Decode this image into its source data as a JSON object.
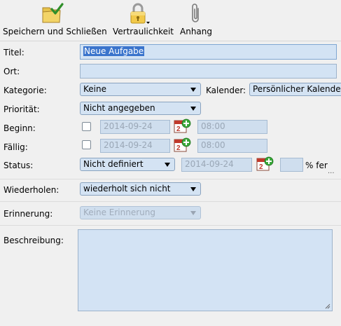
{
  "toolbar": {
    "save_close": "Speichern und Schließen",
    "confidentiality": "Vertraulichkeit",
    "attachment": "Anhang"
  },
  "form": {
    "title_label": "Titel:",
    "title_value": "Neue Aufgabe",
    "location_label": "Ort:",
    "location_value": "",
    "category_label": "Kategorie:",
    "category_value": "Keine",
    "calendar_label": "Kalender:",
    "calendar_value": "Persönlicher Kalende",
    "priority_label": "Priorität:",
    "priority_value": "Nicht angegeben",
    "start_label": "Beginn:",
    "start_date": "2014-09-24",
    "start_time": "08:00",
    "due_label": "Fällig:",
    "due_date": "2014-09-24",
    "due_time": "08:00",
    "status_label": "Status:",
    "status_value": "Nicht definiert",
    "status_date": "2014-09-24",
    "percent_value": "",
    "percent_label": "% fer",
    "more_dots": "...",
    "repeat_label": "Wiederholen:",
    "repeat_value": "wiederholt sich nicht",
    "reminder_label": "Erinnerung:",
    "reminder_value": "Keine Erinnerung",
    "description_label": "Beschreibung:",
    "description_value": ""
  },
  "colors": {
    "field_bg": "#d3e3f4",
    "field_border": "#9db3cb",
    "selection": "#3a74cc",
    "background": "#f0f0f0"
  },
  "icons": {
    "save_close": "folder-checkmark-icon",
    "confidentiality": "padlock-icon",
    "attachment": "paperclip-icon",
    "calendar": "calendar-add-icon"
  }
}
